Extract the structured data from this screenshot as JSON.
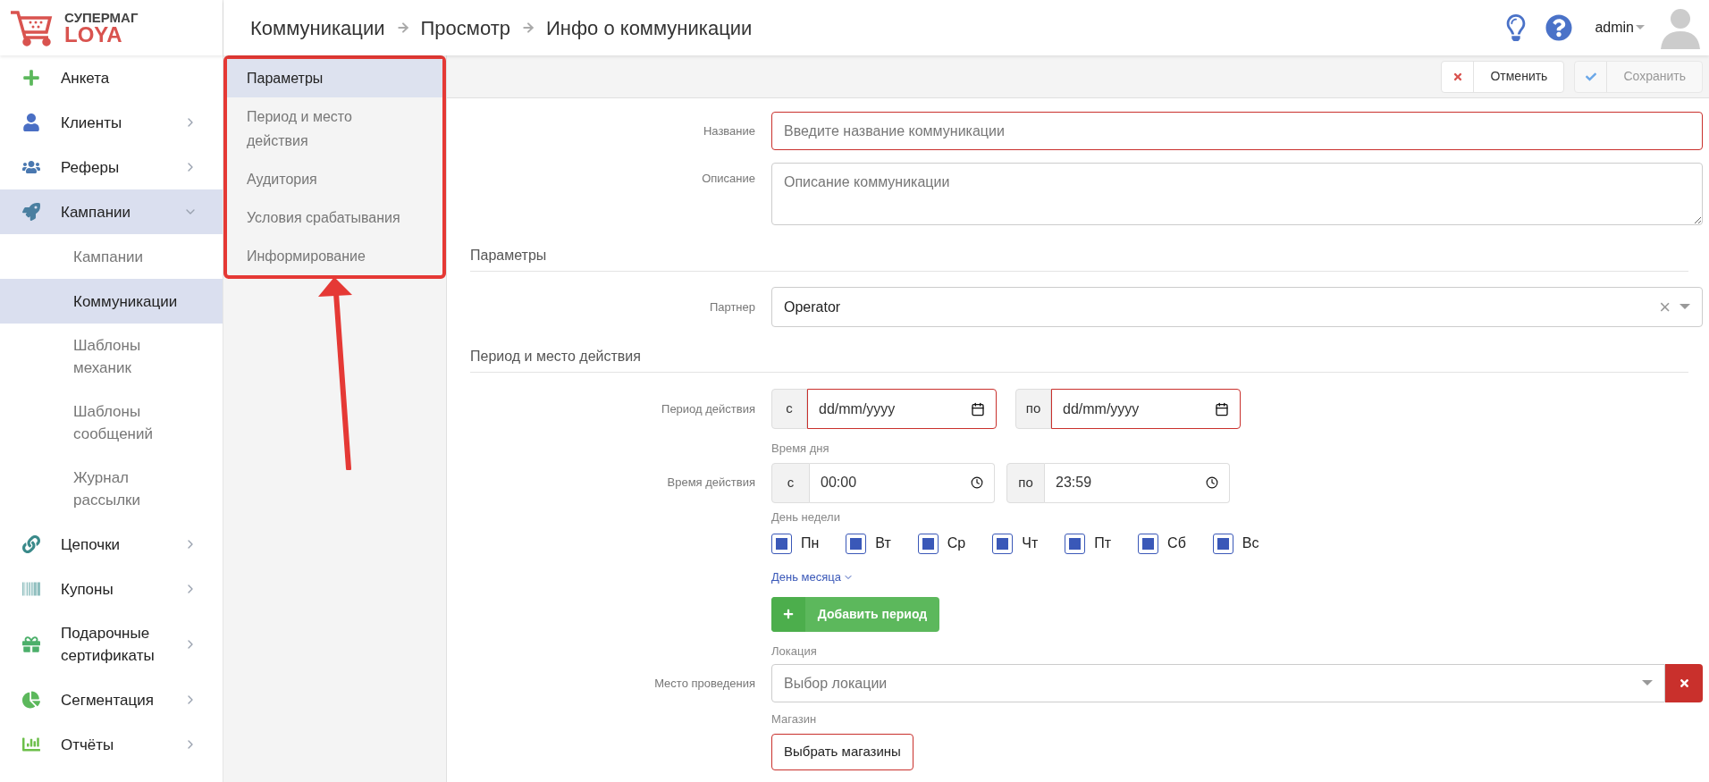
{
  "logo": {
    "line1": "СУПЕРМАГ",
    "line2": "LOYA"
  },
  "breadcrumbs": [
    "Коммуникации",
    "Просмотр",
    "Инфо о коммуникации"
  ],
  "user": {
    "name": "admin"
  },
  "sidebar": {
    "items": [
      {
        "label": "Анкета",
        "selected": false
      },
      {
        "label": "Клиенты",
        "selected": false,
        "expanded": false
      },
      {
        "label": "Реферы",
        "selected": false,
        "expanded": false
      },
      {
        "label": "Кампании",
        "selected": true,
        "expanded": true,
        "children": [
          {
            "label": "Кампании",
            "selected": false
          },
          {
            "label": "Коммуникации",
            "selected": true
          },
          {
            "label": "Шаблоны механик",
            "selected": false
          },
          {
            "label": "Шаблоны сообщений",
            "selected": false
          },
          {
            "label": "Журнал рассылки",
            "selected": false
          }
        ]
      },
      {
        "label": "Цепочки",
        "selected": false,
        "expanded": false
      },
      {
        "label": "Купоны",
        "selected": false,
        "expanded": false
      },
      {
        "label": "Подарочные сертификаты",
        "selected": false,
        "expanded": false
      },
      {
        "label": "Сегментация",
        "selected": false,
        "expanded": false
      },
      {
        "label": "Отчёты",
        "selected": false,
        "expanded": false
      }
    ]
  },
  "sections_nav": [
    {
      "label": "Параметры",
      "selected": true
    },
    {
      "label": "Период и место действия",
      "selected": false
    },
    {
      "label": "Аудитория",
      "selected": false
    },
    {
      "label": "Условия срабатывания",
      "selected": false
    },
    {
      "label": "Информирование",
      "selected": false
    }
  ],
  "toolbar": {
    "cancel": {
      "label": "Отменить",
      "disabled": false
    },
    "save": {
      "label": "Сохранить",
      "disabled": true
    }
  },
  "form": {
    "name": {
      "label": "Название",
      "placeholder": "Введите название коммуникации",
      "invalid": true
    },
    "description": {
      "label": "Описание",
      "placeholder": "Описание коммуникации"
    },
    "section_params": "Параметры",
    "partner": {
      "label": "Партнер",
      "value": "Operator",
      "clear": "×"
    },
    "section_period": "Период и место действия",
    "period": {
      "label": "Период действия",
      "from_prefix": "с",
      "from_placeholder": "dd/mm/yyyy",
      "from_invalid": true,
      "to_prefix": "по",
      "to_placeholder": "dd/mm/yyyy",
      "to_invalid": true
    },
    "time": {
      "caption": "Время дня",
      "label": "Время действия",
      "from_prefix": "с",
      "from_value": "00:00",
      "to_prefix": "по",
      "to_value": "23:59"
    },
    "weekdays_caption": "День недели",
    "weekdays": [
      {
        "label": "Пн",
        "checked": true
      },
      {
        "label": "Вт",
        "checked": true
      },
      {
        "label": "Ср",
        "checked": true
      },
      {
        "label": "Чт",
        "checked": true
      },
      {
        "label": "Пт",
        "checked": true
      },
      {
        "label": "Сб",
        "checked": true
      },
      {
        "label": "Вс",
        "checked": true
      }
    ],
    "month_day_link": "День месяца",
    "add_period": "Добавить период",
    "location": {
      "caption": "Локация",
      "label": "Место проведения",
      "placeholder": "Выбор локации"
    },
    "store": {
      "caption": "Магазин",
      "button": "Выбрать магазины",
      "invalid": true
    }
  }
}
